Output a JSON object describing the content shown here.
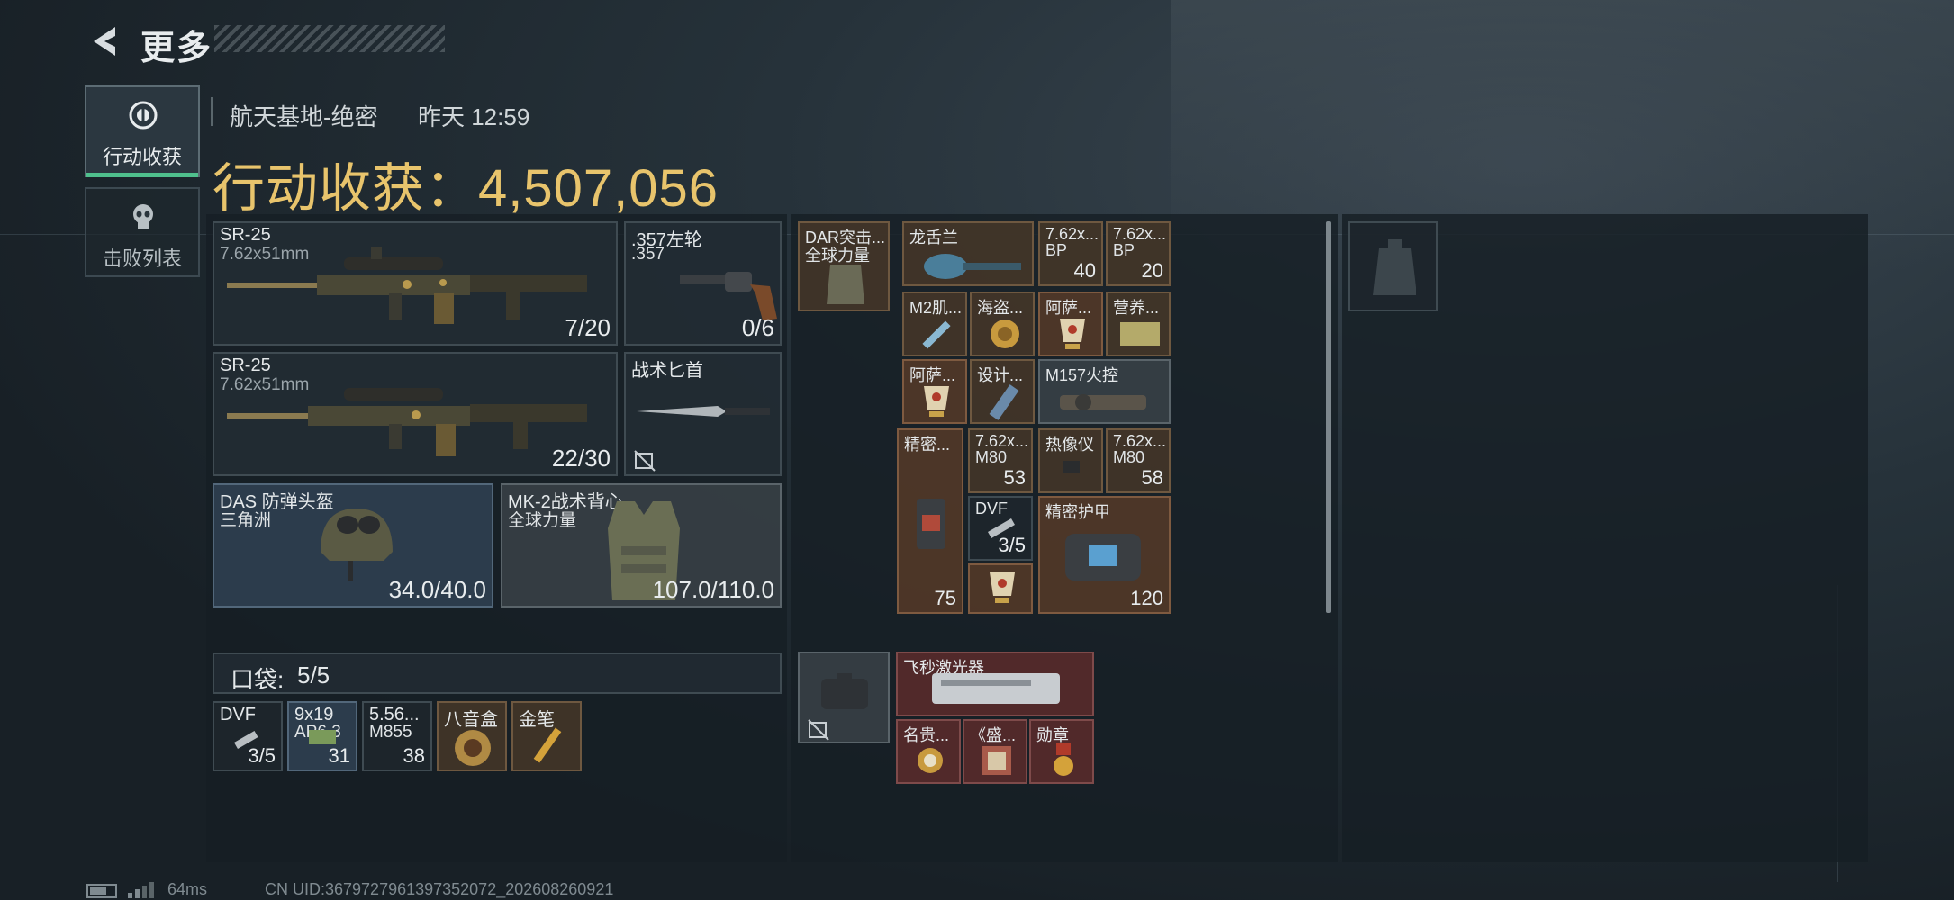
{
  "header": {
    "title": "更多"
  },
  "tabs": [
    {
      "label": "行动收获",
      "active": true
    },
    {
      "label": "击败列表",
      "active": false
    }
  ],
  "raid": {
    "location": "航天基地-绝密",
    "time": "昨天 12:59",
    "harvest_label": "行动收获：",
    "harvest_value": "4,507,056"
  },
  "loadout": {
    "weapon1": {
      "name": "SR-25",
      "caliber": "7.62x51mm",
      "ammo": "7/20"
    },
    "sidearm": {
      "name": ".357左轮",
      "caliber": ".357",
      "ammo": "0/6"
    },
    "weapon2": {
      "name": "SR-25",
      "caliber": "7.62x51mm",
      "ammo": "22/30"
    },
    "melee": {
      "name": "战术匕首"
    },
    "helmet": {
      "name": "DAS 防弹头盔",
      "faction": "三角洲",
      "durability": "34.0/40.0"
    },
    "armor": {
      "name": "MK-2战术背心",
      "faction": "全球力量",
      "durability": "107.0/110.0"
    }
  },
  "pocket": {
    "label": "口袋:",
    "value": "5/5",
    "items": [
      {
        "name": "DVF",
        "count": "3/5"
      },
      {
        "name": "9x19",
        "sub": "AP6.3",
        "count": "31"
      },
      {
        "name": "5.56...",
        "sub": "M855",
        "count": "38"
      },
      {
        "name": "八音盒",
        "count": ""
      },
      {
        "name": "金笔",
        "count": ""
      }
    ]
  },
  "rig": {
    "name": "DAR突击...",
    "faction": "全球力量"
  },
  "rig_items": [
    {
      "name": "龙舌兰",
      "count": ""
    },
    {
      "name": "7.62x...",
      "sub": "BP",
      "count": "40"
    },
    {
      "name": "7.62x...",
      "sub": "BP",
      "count": "20"
    },
    {
      "name": "M2肌...",
      "count": ""
    },
    {
      "name": "海盗...",
      "count": ""
    },
    {
      "name": "阿萨...",
      "count": ""
    },
    {
      "name": "营养...",
      "count": ""
    },
    {
      "name": "阿萨...",
      "count": ""
    },
    {
      "name": "设计...",
      "count": ""
    },
    {
      "name": "M157火控",
      "count": ""
    },
    {
      "name": "精密...",
      "count": "75"
    },
    {
      "name": "7.62x...",
      "sub": "M80",
      "count": "53"
    },
    {
      "name": "热像仪",
      "count": ""
    },
    {
      "name": "7.62x...",
      "sub": "M80",
      "count": "58"
    },
    {
      "name": "DVF",
      "count": "3/5"
    },
    {
      "name": "精密护甲",
      "count": "120"
    }
  ],
  "case": {
    "items": [
      {
        "name": "飞秒激光器"
      },
      {
        "name": "名贵..."
      },
      {
        "name": "《盛..."
      },
      {
        "name": "勋章"
      }
    ]
  },
  "footer": {
    "ping": "64ms",
    "uid": "CN UID:3679727961397352072_202608260921"
  },
  "colors": {
    "accent_green": "#4fc08d",
    "harvest_gold": "#e8c46c"
  }
}
